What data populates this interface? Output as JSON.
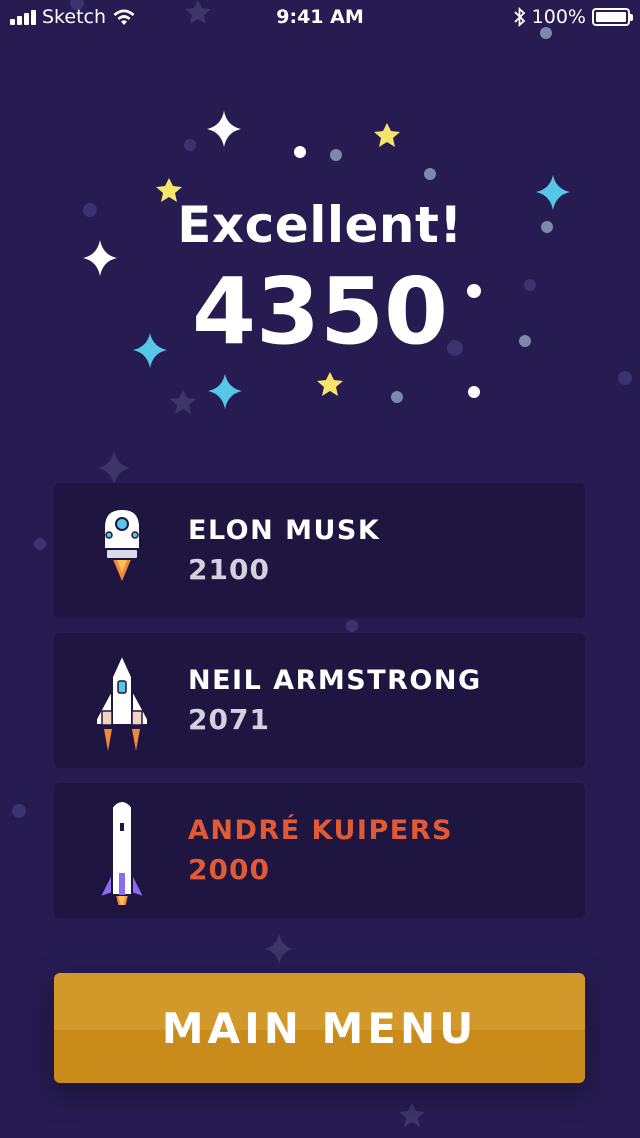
{
  "status_bar": {
    "carrier": "Sketch",
    "time": "9:41 AM",
    "battery": "100%",
    "icons": [
      "signal-icon",
      "wifi-icon",
      "bluetooth-icon",
      "battery-icon"
    ]
  },
  "result": {
    "heading": "Excellent!",
    "score": "4350"
  },
  "leaderboard": [
    {
      "name": "ELON MUSK",
      "score": "2100",
      "icon": "capsule-rocket-icon"
    },
    {
      "name": "NEIL ARMSTRONG",
      "score": "2071",
      "icon": "shuttle-icon"
    },
    {
      "name": "ANDRÉ KUIPERS",
      "score": "2000",
      "icon": "tall-rocket-icon",
      "highlight": true
    }
  ],
  "main_menu_label": "MAIN MENU",
  "colors": {
    "background": "#261c52",
    "card": "#1e1640",
    "highlight": "#e05a35",
    "button": "#d3982a",
    "star_yellow": "#f7e46b",
    "star_cyan": "#56c8e6"
  }
}
